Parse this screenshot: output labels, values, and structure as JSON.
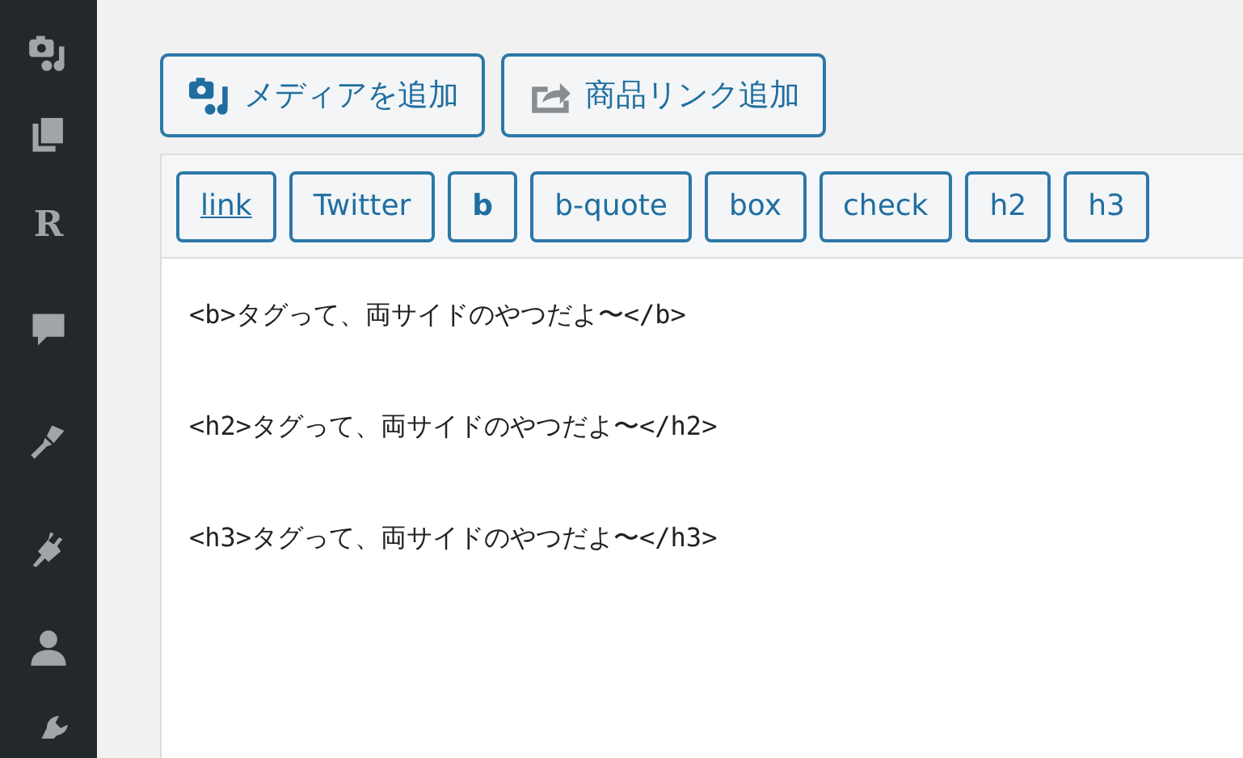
{
  "sidebar": {
    "items": [
      {
        "kind": "media"
      },
      {
        "kind": "pages"
      },
      {
        "kind": "glyph",
        "text": "R"
      },
      {
        "kind": "comments"
      },
      {
        "kind": "appearance"
      },
      {
        "kind": "plugins"
      },
      {
        "kind": "users"
      },
      {
        "kind": "tools"
      }
    ]
  },
  "media_buttons": [
    {
      "kind": "media",
      "label": "メディアを追加"
    },
    {
      "kind": "share",
      "label": "商品リンク追加"
    }
  ],
  "quicktags": [
    {
      "kind": "link",
      "label": "link"
    },
    {
      "kind": "plain",
      "label": "Twitter"
    },
    {
      "kind": "bold",
      "label": "b"
    },
    {
      "kind": "plain",
      "label": "b-quote"
    },
    {
      "kind": "plain",
      "label": "box"
    },
    {
      "kind": "plain",
      "label": "check"
    },
    {
      "kind": "plain",
      "label": "h2"
    },
    {
      "kind": "plain",
      "label": "h3"
    }
  ],
  "editor": {
    "lines": [
      "<b>タグって、両サイドのやつだよ〜</b>",
      "<h2>タグって、両サイドのやつだよ〜</h2>",
      "<h3>タグって、両サイドのやつだよ〜</h3>"
    ]
  }
}
